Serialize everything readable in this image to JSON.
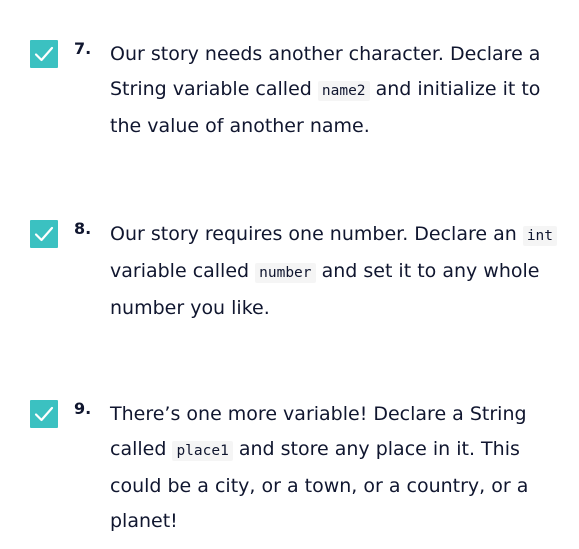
{
  "tasks": [
    {
      "number": "7.",
      "completed": true,
      "text": [
        "Our story needs another character. Declare a String variable called ",
        "name2",
        " and initialize it to the value of another name."
      ]
    },
    {
      "number": "8.",
      "completed": true,
      "text": [
        "Our story requires one number. Declare an ",
        "int",
        " variable called ",
        "number",
        " and set it to any whole number you like."
      ]
    },
    {
      "number": "9.",
      "completed": true,
      "text": [
        "There’s one more variable! Declare a String called ",
        "place1",
        " and store any place in it. This could be a city, or a town, or a country, or a planet!"
      ]
    }
  ],
  "icons": {
    "checkbox": "check-icon"
  },
  "colors": {
    "checkbox_fill": "#3bc1c1",
    "checkmark": "#ffffff",
    "text": "#10162f",
    "code_background": "#f5f5f5"
  }
}
